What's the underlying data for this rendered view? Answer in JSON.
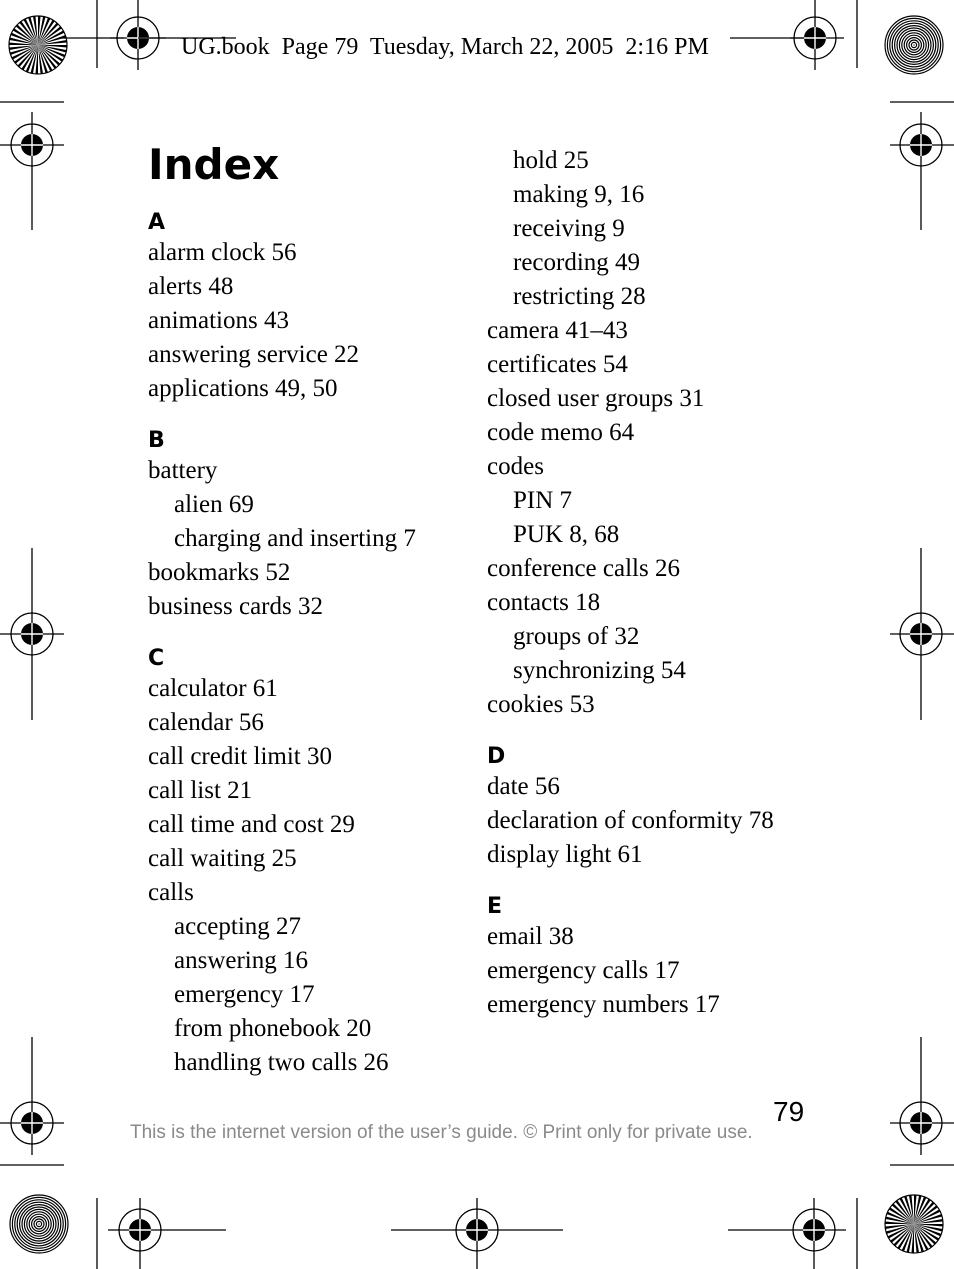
{
  "header": {
    "text": "UG.book  Page 79  Tuesday, March 22, 2005  2:16 PM"
  },
  "title": "Index",
  "columns": {
    "left": [
      {
        "letter": "A",
        "entries": [
          {
            "text": "alarm clock 56",
            "sub": false
          },
          {
            "text": "alerts 48",
            "sub": false
          },
          {
            "text": "animations 43",
            "sub": false
          },
          {
            "text": "answering service 22",
            "sub": false
          },
          {
            "text": "applications 49, 50",
            "sub": false
          }
        ]
      },
      {
        "letter": "B",
        "entries": [
          {
            "text": "battery",
            "sub": false
          },
          {
            "text": "alien 69",
            "sub": true
          },
          {
            "text": "charging and inserting 7",
            "sub": true
          },
          {
            "text": "bookmarks 52",
            "sub": false
          },
          {
            "text": "business cards 32",
            "sub": false
          }
        ]
      },
      {
        "letter": "C",
        "entries": [
          {
            "text": "calculator 61",
            "sub": false
          },
          {
            "text": "calendar 56",
            "sub": false
          },
          {
            "text": "call credit limit 30",
            "sub": false
          },
          {
            "text": "call list 21",
            "sub": false
          },
          {
            "text": "call time and cost 29",
            "sub": false
          },
          {
            "text": "call waiting 25",
            "sub": false
          },
          {
            "text": "calls",
            "sub": false
          },
          {
            "text": "accepting 27",
            "sub": true
          },
          {
            "text": "answering 16",
            "sub": true
          },
          {
            "text": "emergency 17",
            "sub": true
          },
          {
            "text": "from phonebook 20",
            "sub": true
          },
          {
            "text": "handling two calls 26",
            "sub": true
          }
        ]
      }
    ],
    "right": [
      {
        "letter": "",
        "entries": [
          {
            "text": "hold 25",
            "sub": true
          },
          {
            "text": "making 9, 16",
            "sub": true
          },
          {
            "text": "receiving 9",
            "sub": true
          },
          {
            "text": "recording 49",
            "sub": true
          },
          {
            "text": "restricting 28",
            "sub": true
          },
          {
            "text": "camera 41–43",
            "sub": false
          },
          {
            "text": "certificates 54",
            "sub": false
          },
          {
            "text": "closed user groups 31",
            "sub": false
          },
          {
            "text": "code memo 64",
            "sub": false
          },
          {
            "text": "codes",
            "sub": false
          },
          {
            "text": "PIN 7",
            "sub": true
          },
          {
            "text": "PUK 8, 68",
            "sub": true
          },
          {
            "text": "conference calls 26",
            "sub": false
          },
          {
            "text": "contacts 18",
            "sub": false
          },
          {
            "text": "groups of 32",
            "sub": true
          },
          {
            "text": "synchronizing 54",
            "sub": true
          },
          {
            "text": "cookies 53",
            "sub": false
          }
        ]
      },
      {
        "letter": "D",
        "entries": [
          {
            "text": "date 56",
            "sub": false
          },
          {
            "text": "declaration of conformity 78",
            "sub": false
          },
          {
            "text": "display light 61",
            "sub": false
          }
        ]
      },
      {
        "letter": "E",
        "entries": [
          {
            "text": "email 38",
            "sub": false
          },
          {
            "text": "emergency calls 17",
            "sub": false
          },
          {
            "text": "emergency numbers 17",
            "sub": false
          }
        ]
      }
    ]
  },
  "footer": {
    "page_number": "79",
    "note": "This is the internet version of the user’s guide. © Print only for private use."
  },
  "marks": {
    "registration": "registration-target-icon",
    "star_target": "starburst-target-icon",
    "concentric_target": "concentric-circles-target-icon"
  }
}
